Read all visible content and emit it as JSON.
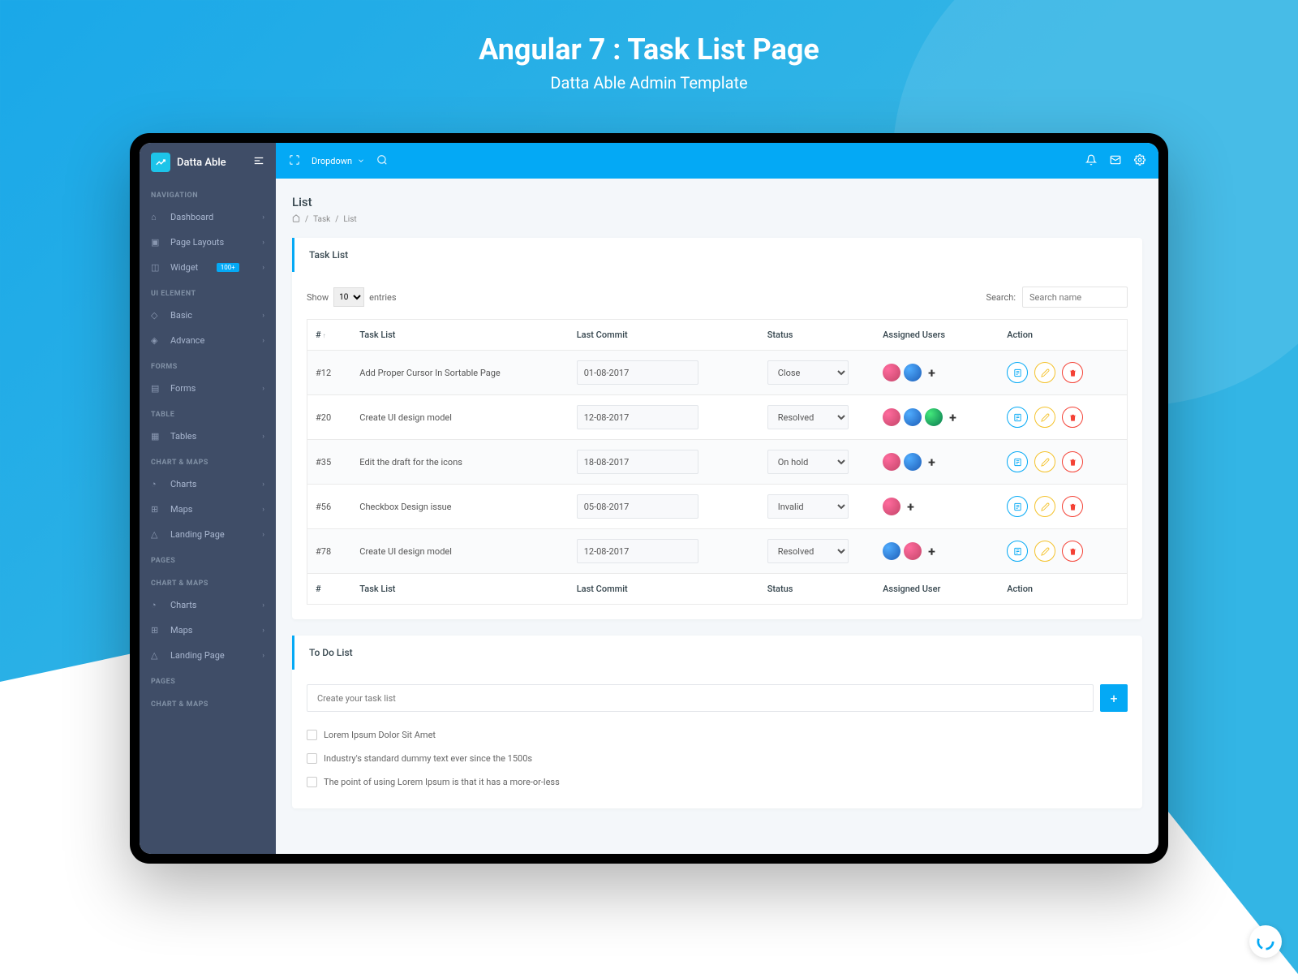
{
  "hero": {
    "title": "Angular 7 : Task List Page",
    "subtitle": "Datta Able Admin Template"
  },
  "brand": "Datta Able",
  "sidebar": {
    "sections": [
      {
        "label": "NAVIGATION",
        "items": [
          {
            "label": "Dashboard"
          },
          {
            "label": "Page Layouts"
          },
          {
            "label": "Widget",
            "badge": "100+"
          }
        ]
      },
      {
        "label": "UI ELEMENT",
        "items": [
          {
            "label": "Basic"
          },
          {
            "label": "Advance"
          }
        ]
      },
      {
        "label": "FORMS",
        "items": [
          {
            "label": "Forms"
          }
        ]
      },
      {
        "label": "TABLE",
        "items": [
          {
            "label": "Tables"
          }
        ]
      },
      {
        "label": "CHART & MAPS",
        "items": [
          {
            "label": "Charts"
          },
          {
            "label": "Maps"
          },
          {
            "label": "Landing Page"
          }
        ]
      },
      {
        "label": "PAGES",
        "items": []
      },
      {
        "label": "CHART & MAPS",
        "items": [
          {
            "label": "Charts"
          },
          {
            "label": "Maps"
          },
          {
            "label": "Landing Page"
          }
        ]
      },
      {
        "label": "PAGES",
        "items": []
      },
      {
        "label": "CHART & MAPS",
        "items": []
      }
    ]
  },
  "topbar": {
    "dropdown": "Dropdown"
  },
  "page": {
    "title": "List",
    "breadcrumb": [
      "Task",
      "List"
    ]
  },
  "taskList": {
    "header": "Task List",
    "showLabel": "Show",
    "entriesLabel": "entries",
    "entriesValue": "10",
    "searchLabel": "Search:",
    "searchPlaceholder": "Search name",
    "columns": [
      "#",
      "Task List",
      "Last Commit",
      "Status",
      "Assigned Users",
      "Action"
    ],
    "footer": [
      "#",
      "Task List",
      "Last Commit",
      "Status",
      "Assigned User",
      "Action"
    ],
    "rows": [
      {
        "id": "#12",
        "task": "Add Proper Cursor In Sortable Page",
        "date": "01-08-2017",
        "status": "Close",
        "avatars": [
          "av1",
          "av2"
        ]
      },
      {
        "id": "#20",
        "task": "Create UI design model",
        "date": "12-08-2017",
        "status": "Resolved",
        "avatars": [
          "av1",
          "av2",
          "av3"
        ]
      },
      {
        "id": "#35",
        "task": "Edit the draft for the icons",
        "date": "18-08-2017",
        "status": "On hold",
        "avatars": [
          "av1",
          "av2"
        ]
      },
      {
        "id": "#56",
        "task": "Checkbox Design issue",
        "date": "05-08-2017",
        "status": "Invalid",
        "avatars": [
          "av1"
        ]
      },
      {
        "id": "#78",
        "task": "Create UI design model",
        "date": "12-08-2017",
        "status": "Resolved",
        "avatars": [
          "av2",
          "av1"
        ]
      }
    ]
  },
  "todo": {
    "header": "To Do List",
    "placeholder": "Create your task list",
    "items": [
      "Lorem Ipsum Dolor Sit Amet",
      "Industry's standard dummy text ever since the 1500s",
      "The point of using Lorem Ipsum is that it has a more-or-less"
    ]
  }
}
